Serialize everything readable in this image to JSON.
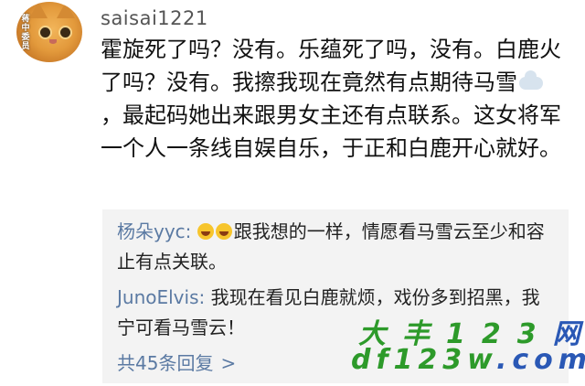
{
  "comment": {
    "username": "saisai1221",
    "avatar_icon": "orange-cat-avatar",
    "avatar_stamp": "蒋中委员",
    "text_before_emoji": "霍旋死了吗？没有。乐蕴死了吗，没有。白鹿火了吗？没有。我擦我现在竟然有点期待马雪",
    "text_after_emoji": "，最起码她出来跟男女主还有点联系。这女将军一个人一条线自娱自乐，于正和白鹿开心就好。",
    "emoji_icon": "cloud-emoji"
  },
  "replies": {
    "items": [
      {
        "author": "杨朵yyc:",
        "emoji_icon": "laughing-tears-emoji",
        "text": "跟我想的一样，情愿看马雪云至少和容止有点关联。"
      },
      {
        "author": "JunoElvis:",
        "text": "我现在看见白鹿就烦，戏份多到招黑，我宁可看马雪云！"
      }
    ],
    "more_label": "共45条回复",
    "more_chevron": ">"
  },
  "watermark": {
    "line1_green": "大丰123",
    "line1_blue": "网",
    "line2_green": "df123w",
    "line2_blue": ".com"
  },
  "colors": {
    "link_blue": "#5b7aa3",
    "reply_bg": "#f3f3f3",
    "watermark_green": "#2d9a2a",
    "watermark_blue": "#2a58b5"
  }
}
